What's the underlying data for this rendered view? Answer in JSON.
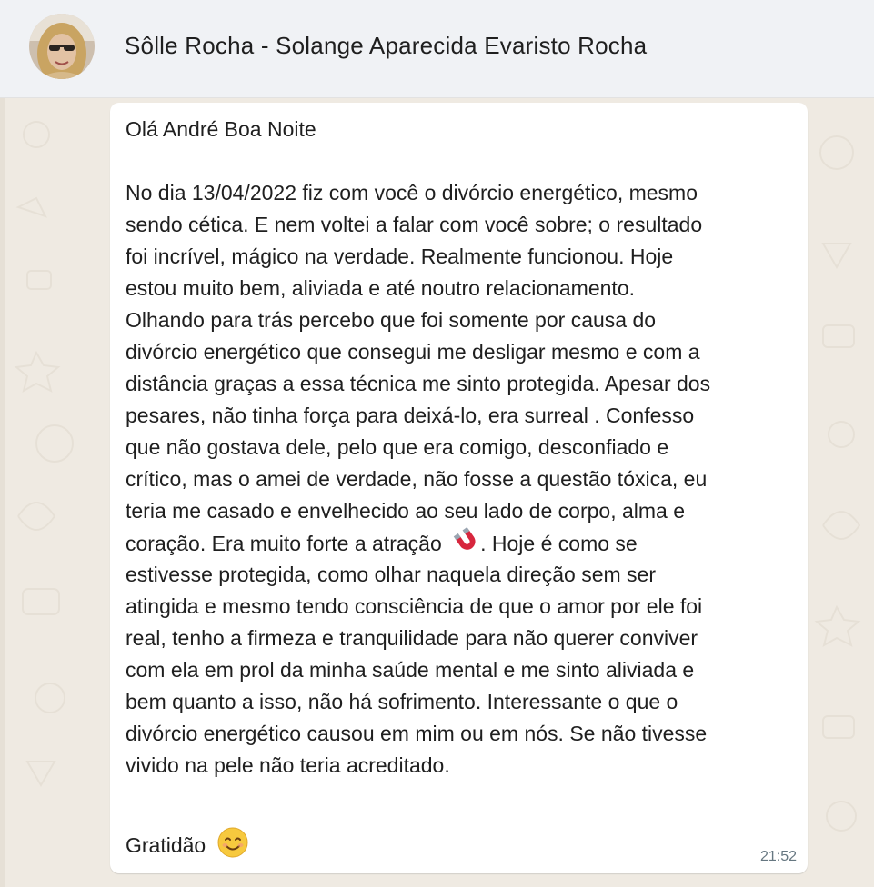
{
  "header": {
    "contact_name": "Sôlle Rocha - Solange Aparecida Evaristo Rocha"
  },
  "message": {
    "lines": [
      "Olá André Boa Noite",
      "",
      "No dia 13/04/2022 fiz com você o divórcio energético, mesmo",
      "sendo cética. E nem voltei a falar com você sobre; o resultado",
      "foi incrível, mágico na verdade. Realmente funcionou. Hoje",
      "estou muito bem, aliviada e até noutro relacionamento.",
      "Olhando para trás percebo que foi somente por causa do",
      "divórcio energético que consegui me desligar mesmo e com a",
      "distância graças a essa técnica me sinto protegida. Apesar dos",
      "pesares, não tinha força para deixá-lo, era surreal . Confesso",
      "que não gostava dele, pelo que era comigo, desconfiado e",
      "crítico, mas o amei de verdade, não fosse a questão tóxica, eu",
      "teria me casado e envelhecido ao seu lado de corpo, alma e",
      "coração. Era muito forte a atração",
      ". Hoje é como se",
      "estivesse protegida, como olhar naquela direção sem ser",
      "atingida e mesmo tendo consciência de que o amor por ele foi",
      "real, tenho a firmeza e tranquilidade para não querer conviver",
      "com ela em prol da minha saúde mental e me sinto aliviada e",
      "bem quanto a isso, não há sofrimento. Interessante o que o",
      "divórcio energético causou em mim ou em nós. Se não tivesse",
      "vivido na pele não teria acreditado.",
      "",
      "Gratidão"
    ],
    "timestamp": "21:52"
  },
  "icons": {
    "magnet": "magnet-emoji-icon",
    "smile": "smiling-face-emoji-icon"
  },
  "colors": {
    "header_bg": "#f0f2f5",
    "chat_bg": "#efeae2",
    "bubble_bg": "#ffffff",
    "text": "#1f1f1f",
    "timestamp": "#667781"
  }
}
